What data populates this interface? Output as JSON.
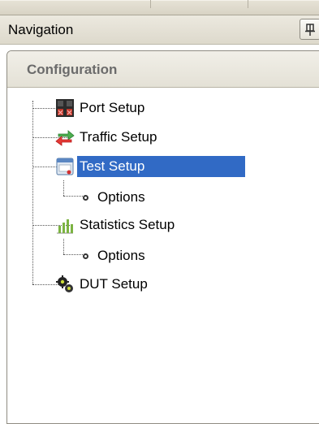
{
  "window": {
    "nav_title": "Navigation"
  },
  "panel": {
    "title": "Configuration"
  },
  "tree": {
    "items": [
      {
        "label": "Port Setup",
        "icon": "port-setup-icon"
      },
      {
        "label": "Traffic Setup",
        "icon": "traffic-setup-icon"
      },
      {
        "label": "Test Setup",
        "icon": "test-setup-icon",
        "selected": true,
        "children": [
          {
            "label": "Options",
            "icon": "options-bullet-icon"
          }
        ]
      },
      {
        "label": "Statistics Setup",
        "icon": "statistics-setup-icon",
        "children": [
          {
            "label": "Options",
            "icon": "options-bullet-icon"
          }
        ]
      },
      {
        "label": "DUT Setup",
        "icon": "dut-setup-icon"
      }
    ]
  },
  "colors": {
    "selection": "#316ac5",
    "header_gradient_top": "#ece9df",
    "panel_title": "#6b6b6b"
  }
}
